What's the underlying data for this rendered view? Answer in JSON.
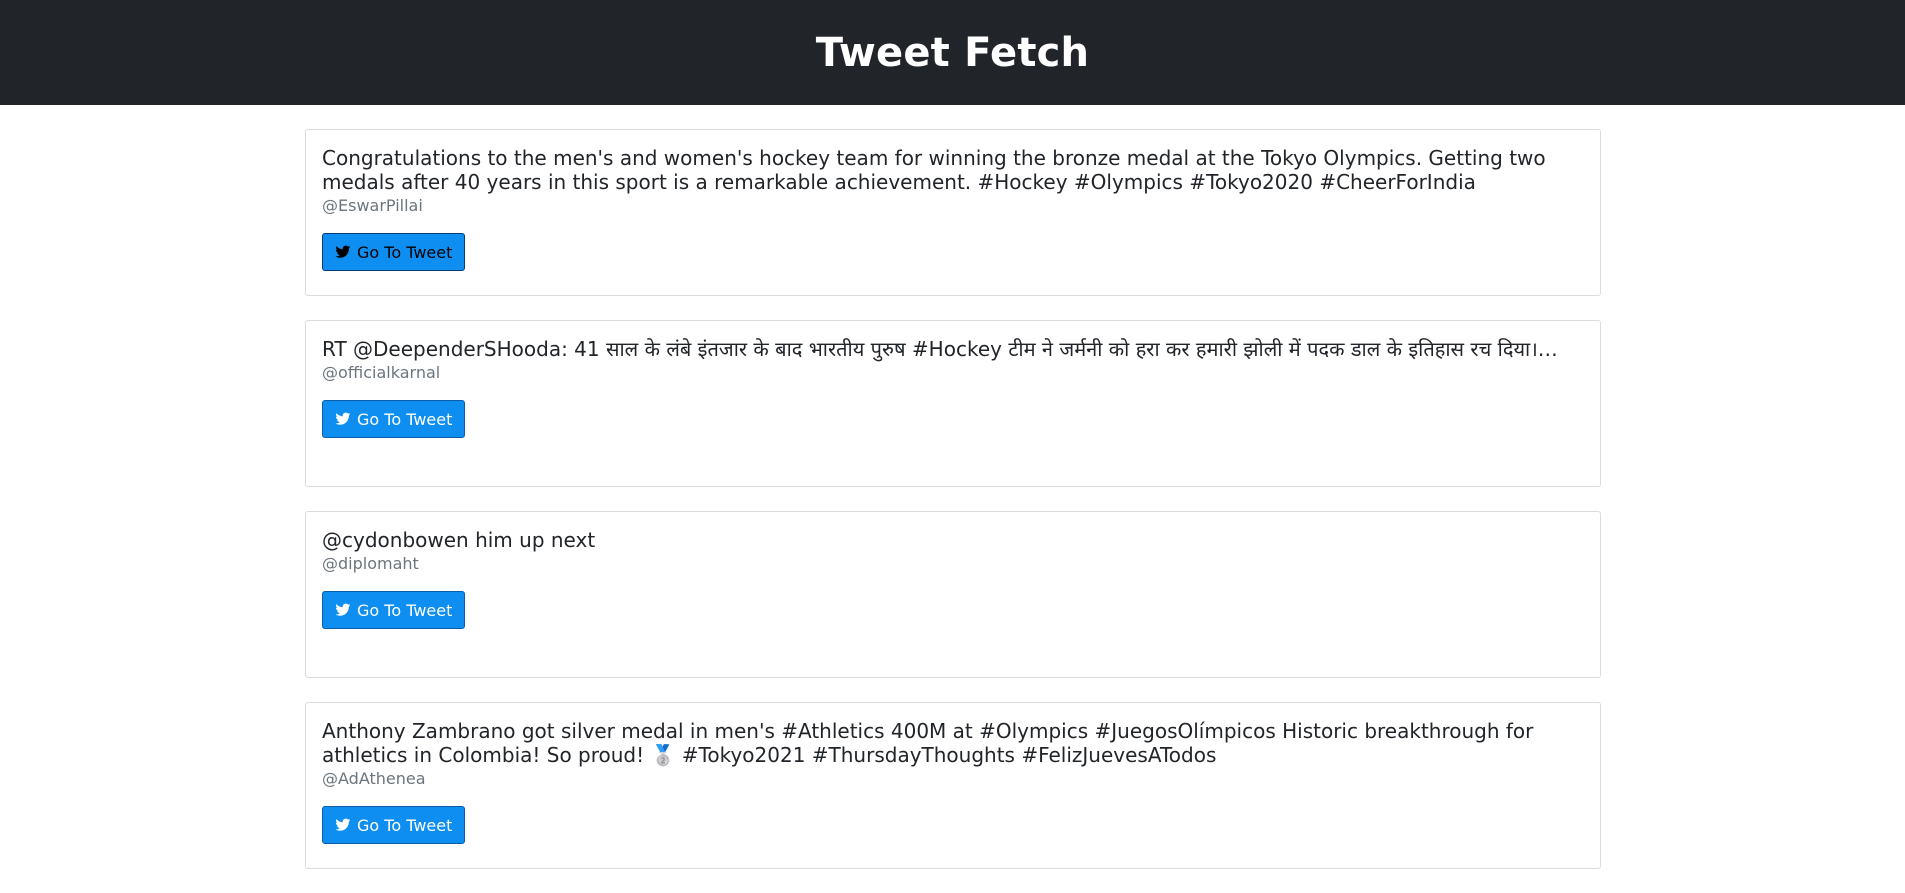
{
  "header": {
    "title": "Tweet Fetch",
    "background": "#212529"
  },
  "tweets": [
    {
      "text": "Congratulations to the men's and women's hockey team for winning the bronze medal at the Tokyo Olympics. Getting two medals after 40 years in this sport is a remarkable achievement. #Hockey #Olympics #Tokyo2020 #CheerForIndia",
      "user": "@EswarPillai",
      "button_label": "Go To Tweet"
    },
    {
      "text": "RT @DeependerSHooda: 41 साल के लंबे इंतजार के बाद भारतीय पुरुष #Hockey टीम ने जर्मनी को हरा कर हमारी झोली में पदक डाल के इतिहास रच दिया।…",
      "user": "@officialkarnal",
      "button_label": "Go To Tweet"
    },
    {
      "text": "@cydonbowen him up next",
      "user": "@diplomaht",
      "button_label": "Go To Tweet"
    },
    {
      "text": "Anthony Zambrano got silver medal in men's #Athletics 400M at #Olympics #JuegosOlímpicos Historic breakthrough for athletics in Colombia! So proud! 🥈 #Tokyo2021 #ThursdayThoughts #FelizJuevesATodos",
      "user": "@AdAthenea",
      "button_label": "Go To Tweet"
    }
  ],
  "icons": {
    "button_icon": "twitter-bird-icon"
  },
  "colors": {
    "button": "#0d8ef0",
    "username": "#6c757d"
  }
}
